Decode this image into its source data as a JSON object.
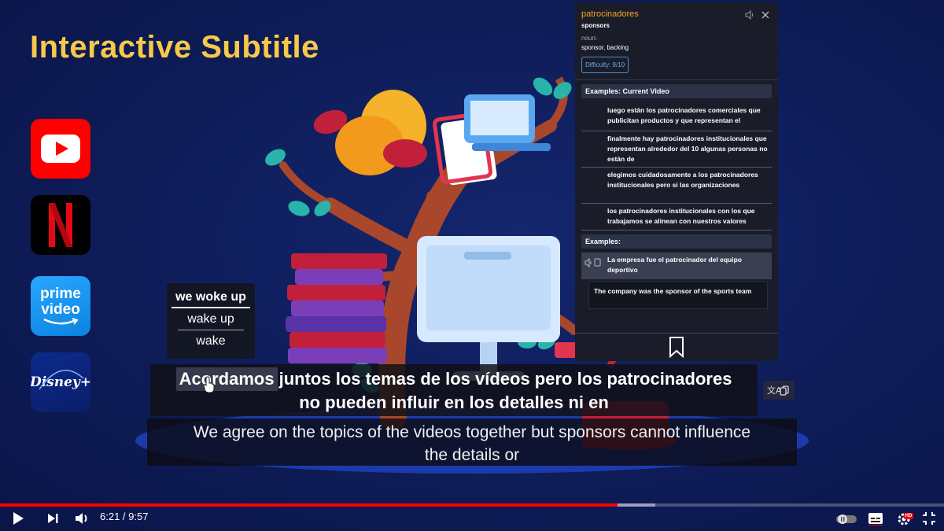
{
  "headline": "Interactive Subtitle",
  "apps": {
    "youtube": "youtube-logo",
    "netflix": "N",
    "prime": {
      "line1": "prime",
      "line2": "video"
    },
    "disney": "Disney+"
  },
  "suggestions": [
    "we woke up",
    "wake up",
    "wake"
  ],
  "subtitle_es": {
    "hovered_word": "Acordamos",
    "line1_rest": "juntos los temas de los vídeos pero los patrocinadores",
    "line2": "no pueden influir en los detalles ni en"
  },
  "subtitle_en": {
    "line1": "We agree on the topics of the videos together but sponsors cannot influence",
    "line2": "the details or"
  },
  "dictionary": {
    "word": "patrocinadores",
    "translation": "sponsors",
    "part_of_speech": "noun:",
    "meaning": "sponsor, backing",
    "difficulty": "Difficulty: 9/10",
    "current_video_header": "Examples: Current Video",
    "current_video_examples": [
      "luego están los patrocinadores comerciales que publicitan productos y que representan el",
      "finalmente hay patrocinadores institucionales que representan alrededor del 10 algunas personas no están de",
      "elegimos cuidadosamente a los patrocinadores institucionales pero si las organizaciones",
      "los patrocinadores institucionales con los que trabajamos se alinean con nuestros valores"
    ],
    "examples_header": "Examples:",
    "example_selected": "La empresa fue el patrocinador del equipo deportivo",
    "example_translation": "The company was the sponsor of the sports team"
  },
  "player": {
    "time": "6:21 / 9:57",
    "progress": 0.654,
    "buffered": 0.694,
    "hd_badge": "HD"
  },
  "colors": {
    "headline": "#f7c948",
    "dict_word": "#f5a623",
    "progress": "#ff0000"
  }
}
